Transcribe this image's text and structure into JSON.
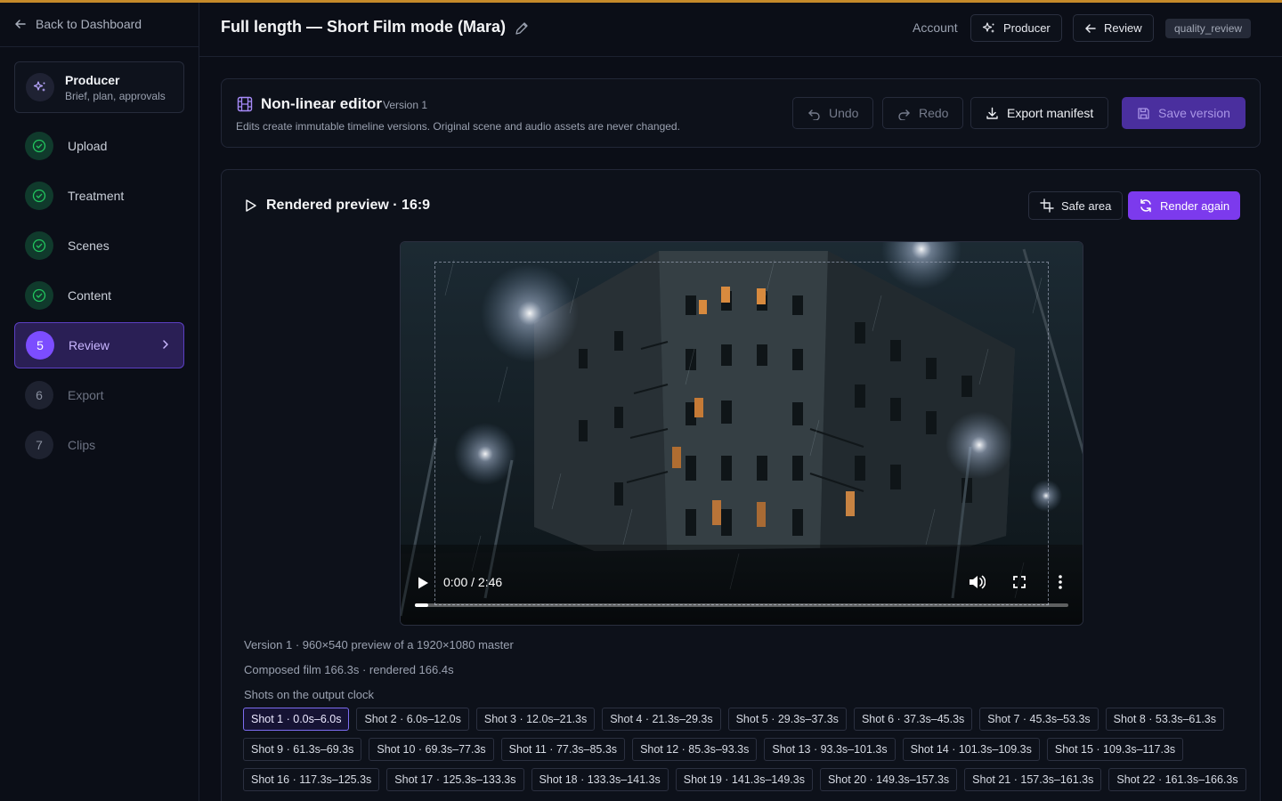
{
  "sidebar": {
    "back_label": "Back to Dashboard",
    "producer": {
      "title": "Producer",
      "subtitle": "Brief, plan, approvals"
    },
    "steps": [
      {
        "label": "Upload",
        "state": "done"
      },
      {
        "label": "Treatment",
        "state": "done"
      },
      {
        "label": "Scenes",
        "state": "done"
      },
      {
        "label": "Content",
        "state": "done"
      },
      {
        "label": "Review",
        "state": "active",
        "number": "5"
      },
      {
        "label": "Export",
        "state": "todo",
        "number": "6"
      },
      {
        "label": "Clips",
        "state": "todo",
        "number": "7"
      }
    ]
  },
  "header": {
    "title": "Full length — Short Film mode (Mara)",
    "account_label": "Account",
    "producer_label": "Producer",
    "review_label": "Review",
    "role_badge": "quality_review"
  },
  "editor": {
    "title": "Non-linear editor",
    "version": "Version 1",
    "description": "Edits create immutable timeline versions. Original scene and audio assets are never changed.",
    "undo_label": "Undo",
    "redo_label": "Redo",
    "export_label": "Export manifest",
    "save_label": "Save version"
  },
  "preview": {
    "title": "Rendered preview · 16:9",
    "safe_area_label": "Safe area",
    "render_label": "Render again",
    "time": "0:00 / 2:46",
    "progress_fraction": 0.02,
    "meta_version": "Version 1 · 960×540 preview of a 1920×1080 master",
    "meta_composed": "Composed film 166.3s · rendered 166.4s",
    "shots_heading": "Shots on the output clock",
    "shots": [
      [
        "Shot 1 · 0.0s–6.0s",
        "Shot 2 · 6.0s–12.0s",
        "Shot 3 · 12.0s–21.3s",
        "Shot 4 · 21.3s–29.3s",
        "Shot 5 · 29.3s–37.3s",
        "Shot 6 · 37.3s–45.3s",
        "Shot 7 · 45.3s–53.3s",
        "Shot 8 · 53.3s–61.3s"
      ],
      [
        "Shot 9 · 61.3s–69.3s",
        "Shot 10 · 69.3s–77.3s",
        "Shot 11 · 77.3s–85.3s",
        "Shot 12 · 85.3s–93.3s",
        "Shot 13 · 93.3s–101.3s",
        "Shot 14 · 101.3s–109.3s",
        "Shot 15 · 109.3s–117.3s"
      ],
      [
        "Shot 16 · 117.3s–125.3s",
        "Shot 17 · 125.3s–133.3s",
        "Shot 18 · 133.3s–141.3s",
        "Shot 19 · 141.3s–149.3s",
        "Shot 20 · 149.3s–157.3s",
        "Shot 21 · 157.3s–161.3s",
        "Shot 22 · 161.3s–166.3s"
      ]
    ],
    "selected_shot": "Shot 1 · 0.0s–6.0s"
  },
  "colors": {
    "accent": "#7c3aed",
    "done_green": "#22c55e",
    "top_line": "#c58a2a"
  },
  "icons": [
    "arrow-left-icon",
    "sparkles-icon",
    "check-circle-icon",
    "chevron-right-icon",
    "pencil-icon",
    "film-icon",
    "undo-icon",
    "redo-icon",
    "download-icon",
    "save-icon",
    "play-outline-icon",
    "crop-icon",
    "refresh-icon",
    "play-icon",
    "volume-icon",
    "fullscreen-icon",
    "more-vertical-icon"
  ]
}
